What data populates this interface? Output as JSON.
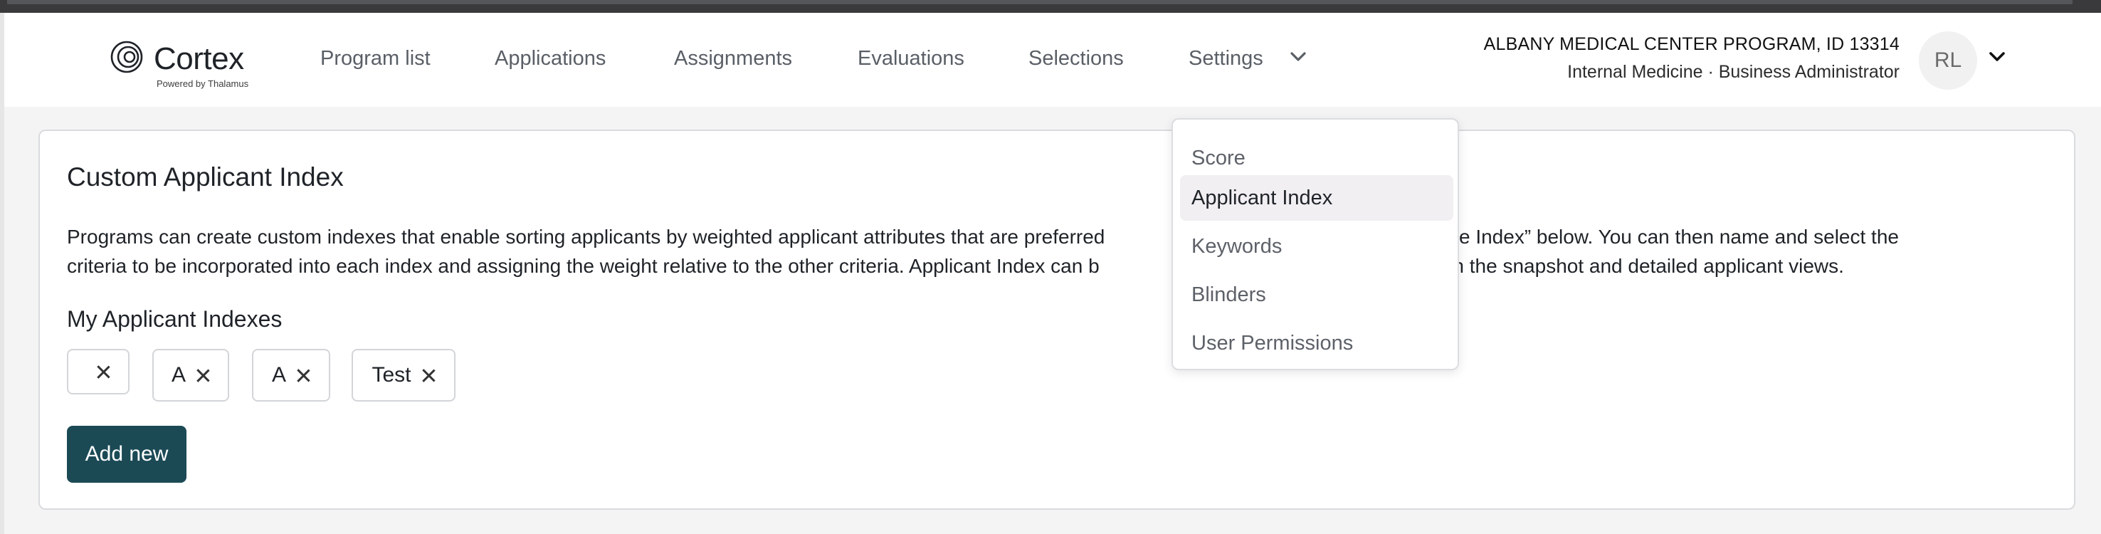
{
  "app": {
    "logo_text": "Cortex",
    "logo_sub": "Powered by Thalamus"
  },
  "nav": {
    "items": [
      "Program list",
      "Applications",
      "Assignments",
      "Evaluations",
      "Selections",
      "Settings"
    ]
  },
  "program": {
    "line1": "ALBANY MEDICAL CENTER PROGRAM, ID 13314",
    "line2": "Internal Medicine · Business Administrator"
  },
  "user": {
    "initials": "RL"
  },
  "card": {
    "title": "Custom Applicant Index",
    "description_left_1": "Programs can create custom indexes that enable sorting applicants by weighted applicant attributes that are preferred",
    "description_right_1": "“Create Index” below. You can then name and select the",
    "description_left_2": "criteria to be incorporated into each index and assigning the weight relative to the other criteria. Applicant Index can b",
    "description_right_2": "ough both the snapshot and detailed applicant views.",
    "section_title": "My Applicant Indexes",
    "chips": [
      "",
      "A",
      "A",
      "Test"
    ],
    "add_label": "Add new"
  },
  "settings_menu": {
    "items": [
      "Score",
      "Applicant Index",
      "Keywords",
      "Blinders",
      "User Permissions"
    ],
    "active": "Applicant Index"
  },
  "colors": {
    "primary_button": "#1b4a55",
    "active_menu_bg": "#f1eff2"
  },
  "icons": {
    "logo": "cortex-logo-icon",
    "settings_chevron": "chevron-down-icon",
    "user_chevron": "chevron-down-icon",
    "chip_remove": "close-icon"
  }
}
